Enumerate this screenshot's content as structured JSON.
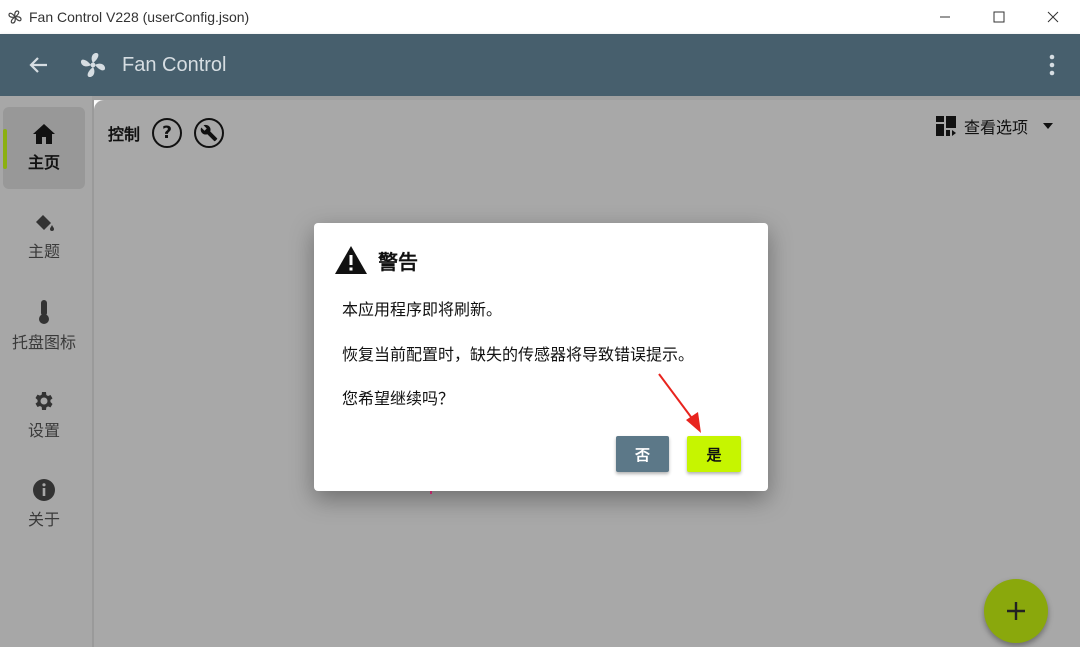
{
  "window": {
    "title": "Fan Control V228 (userConfig.json)"
  },
  "appbar": {
    "name": "Fan Control"
  },
  "sidebar": {
    "items": [
      {
        "label": "主页",
        "icon": "home-icon",
        "active": true
      },
      {
        "label": "主题",
        "icon": "paint-bucket-icon",
        "active": false
      },
      {
        "label": "托盘图标",
        "icon": "thermometer-icon",
        "active": false
      },
      {
        "label": "设置",
        "icon": "gear-icon",
        "active": false
      },
      {
        "label": "关于",
        "icon": "info-icon",
        "active": false
      }
    ]
  },
  "controls": {
    "label": "控制",
    "help_glyph": "?"
  },
  "view_options": {
    "label": "查看选项"
  },
  "dialog": {
    "title": "警告",
    "line1": "本应用程序即将刷新。",
    "line2": "恢复当前配置时，缺失的传感器将导致错误提示。",
    "line3": "您希望继续吗？",
    "no_label": "否",
    "yes_label": "是"
  },
  "colors": {
    "appbar": "#475f6d",
    "accent": "#8bb011",
    "yes_button": "#c6f500",
    "no_button": "#5c7888",
    "annotation_arrow": "#e8241e"
  }
}
